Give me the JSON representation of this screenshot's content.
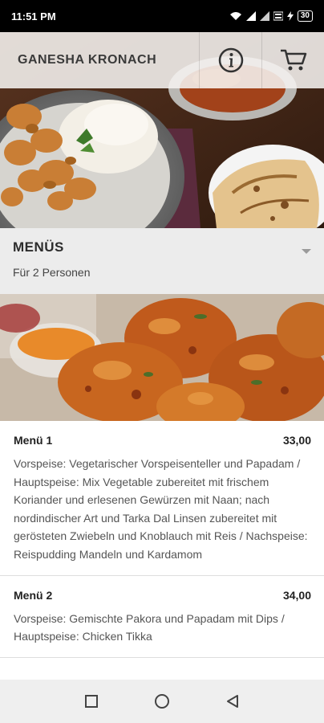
{
  "status_bar": {
    "time": "11:51 PM",
    "battery": "30"
  },
  "header": {
    "title": "GANESHA KRONACH",
    "info_icon": "info-icon",
    "cart_icon": "cart-icon"
  },
  "section": {
    "title": "MENÜS",
    "subtitle": "Für 2 Personen"
  },
  "menu_items": [
    {
      "name": "Menü 1",
      "price": "33,00",
      "description": "Vorspeise: Vegetarischer Vorspeisenteller und Papadam / Hauptspeise: Mix Vegetable zubereitet mit frischem Koriander und erlesenen Gewürzen mit Naan; nach nordindischer Art und Tarka Dal Linsen zubereitet mit gerösteten Zwiebeln und Knoblauch mit Reis / Nachspeise: Reispudding Mandeln und Kardamom"
    },
    {
      "name": "Menü 2",
      "price": "34,00",
      "description": "Vorspeise: Gemischte Pakora und Papadam mit Dips / Hauptspeise: Chicken Tikka"
    }
  ],
  "nav": {
    "recent_icon": "square-icon",
    "home_icon": "circle-icon",
    "back_icon": "triangle-back-icon"
  }
}
